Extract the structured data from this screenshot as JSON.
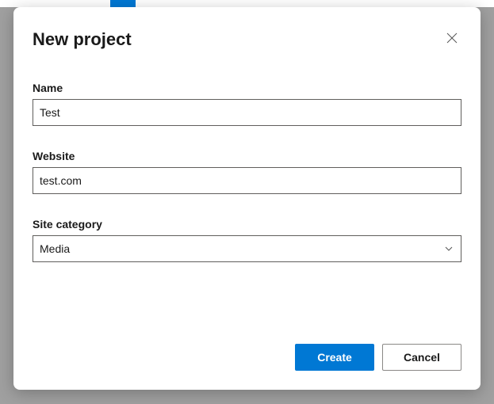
{
  "dialog": {
    "title": "New project",
    "fields": {
      "name": {
        "label": "Name",
        "value": "Test"
      },
      "website": {
        "label": "Website",
        "value": "test.com"
      },
      "category": {
        "label": "Site category",
        "selected": "Media"
      }
    },
    "actions": {
      "primary": "Create",
      "secondary": "Cancel"
    }
  }
}
